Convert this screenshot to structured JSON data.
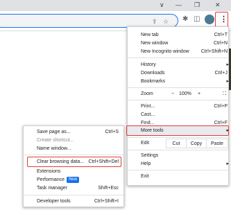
{
  "titlebar": {
    "icons": [
      "chevron-down-icon",
      "minimize-icon",
      "restore-icon",
      "close-icon"
    ],
    "glyphs": [
      "∨",
      "—",
      "❐",
      "✕"
    ]
  },
  "toolbar": {
    "share_glyph": "⇪",
    "star_glyph": "☆",
    "extension_glyph": "✱",
    "sidepanel_glyph": "◫",
    "kebab_glyph": "⋮"
  },
  "main_menu": {
    "items": [
      {
        "label": "New tab",
        "shortcut": "Ctrl+T"
      },
      {
        "label": "New window",
        "shortcut": "Ctrl+N"
      },
      {
        "label": "New Incognito window",
        "shortcut": "Ctrl+Shift+N"
      },
      {
        "label": "History",
        "arrow": "▸"
      },
      {
        "label": "Downloads",
        "shortcut": "Ctrl+J"
      },
      {
        "label": "Bookmarks",
        "arrow": "▸"
      },
      {
        "label": "Print...",
        "shortcut": "Ctrl+P"
      },
      {
        "label": "Cast..."
      },
      {
        "label": "Find...",
        "shortcut": "Ctrl+F"
      },
      {
        "label": "More tools",
        "arrow": "▸"
      },
      {
        "label": "Settings"
      },
      {
        "label": "Help",
        "arrow": "▸"
      },
      {
        "label": "Exit"
      }
    ],
    "zoom": {
      "label": "Zoom",
      "minus": "−",
      "value": "100%",
      "plus": "+",
      "fullscreen": "⛶"
    },
    "edit": {
      "edit": "Edit",
      "cut": "Cut",
      "copy": "Copy",
      "paste": "Paste"
    }
  },
  "sub_menu": {
    "items": [
      {
        "label": "Save page as...",
        "shortcut": "Ctrl+S"
      },
      {
        "label": "Create shortcut..."
      },
      {
        "label": "Name window..."
      },
      {
        "label": "Clear browsing data...",
        "shortcut": "Ctrl+Shift+Del"
      },
      {
        "label": "Extensions"
      },
      {
        "label": "Performance",
        "badge": "New"
      },
      {
        "label": "Task manager",
        "shortcut": "Shift+Esc"
      },
      {
        "label": "Developer tools",
        "shortcut": "Ctrl+Shift+I"
      }
    ]
  },
  "colors": {
    "accent": "#1a73e8",
    "highlight_box": "#e53935"
  }
}
